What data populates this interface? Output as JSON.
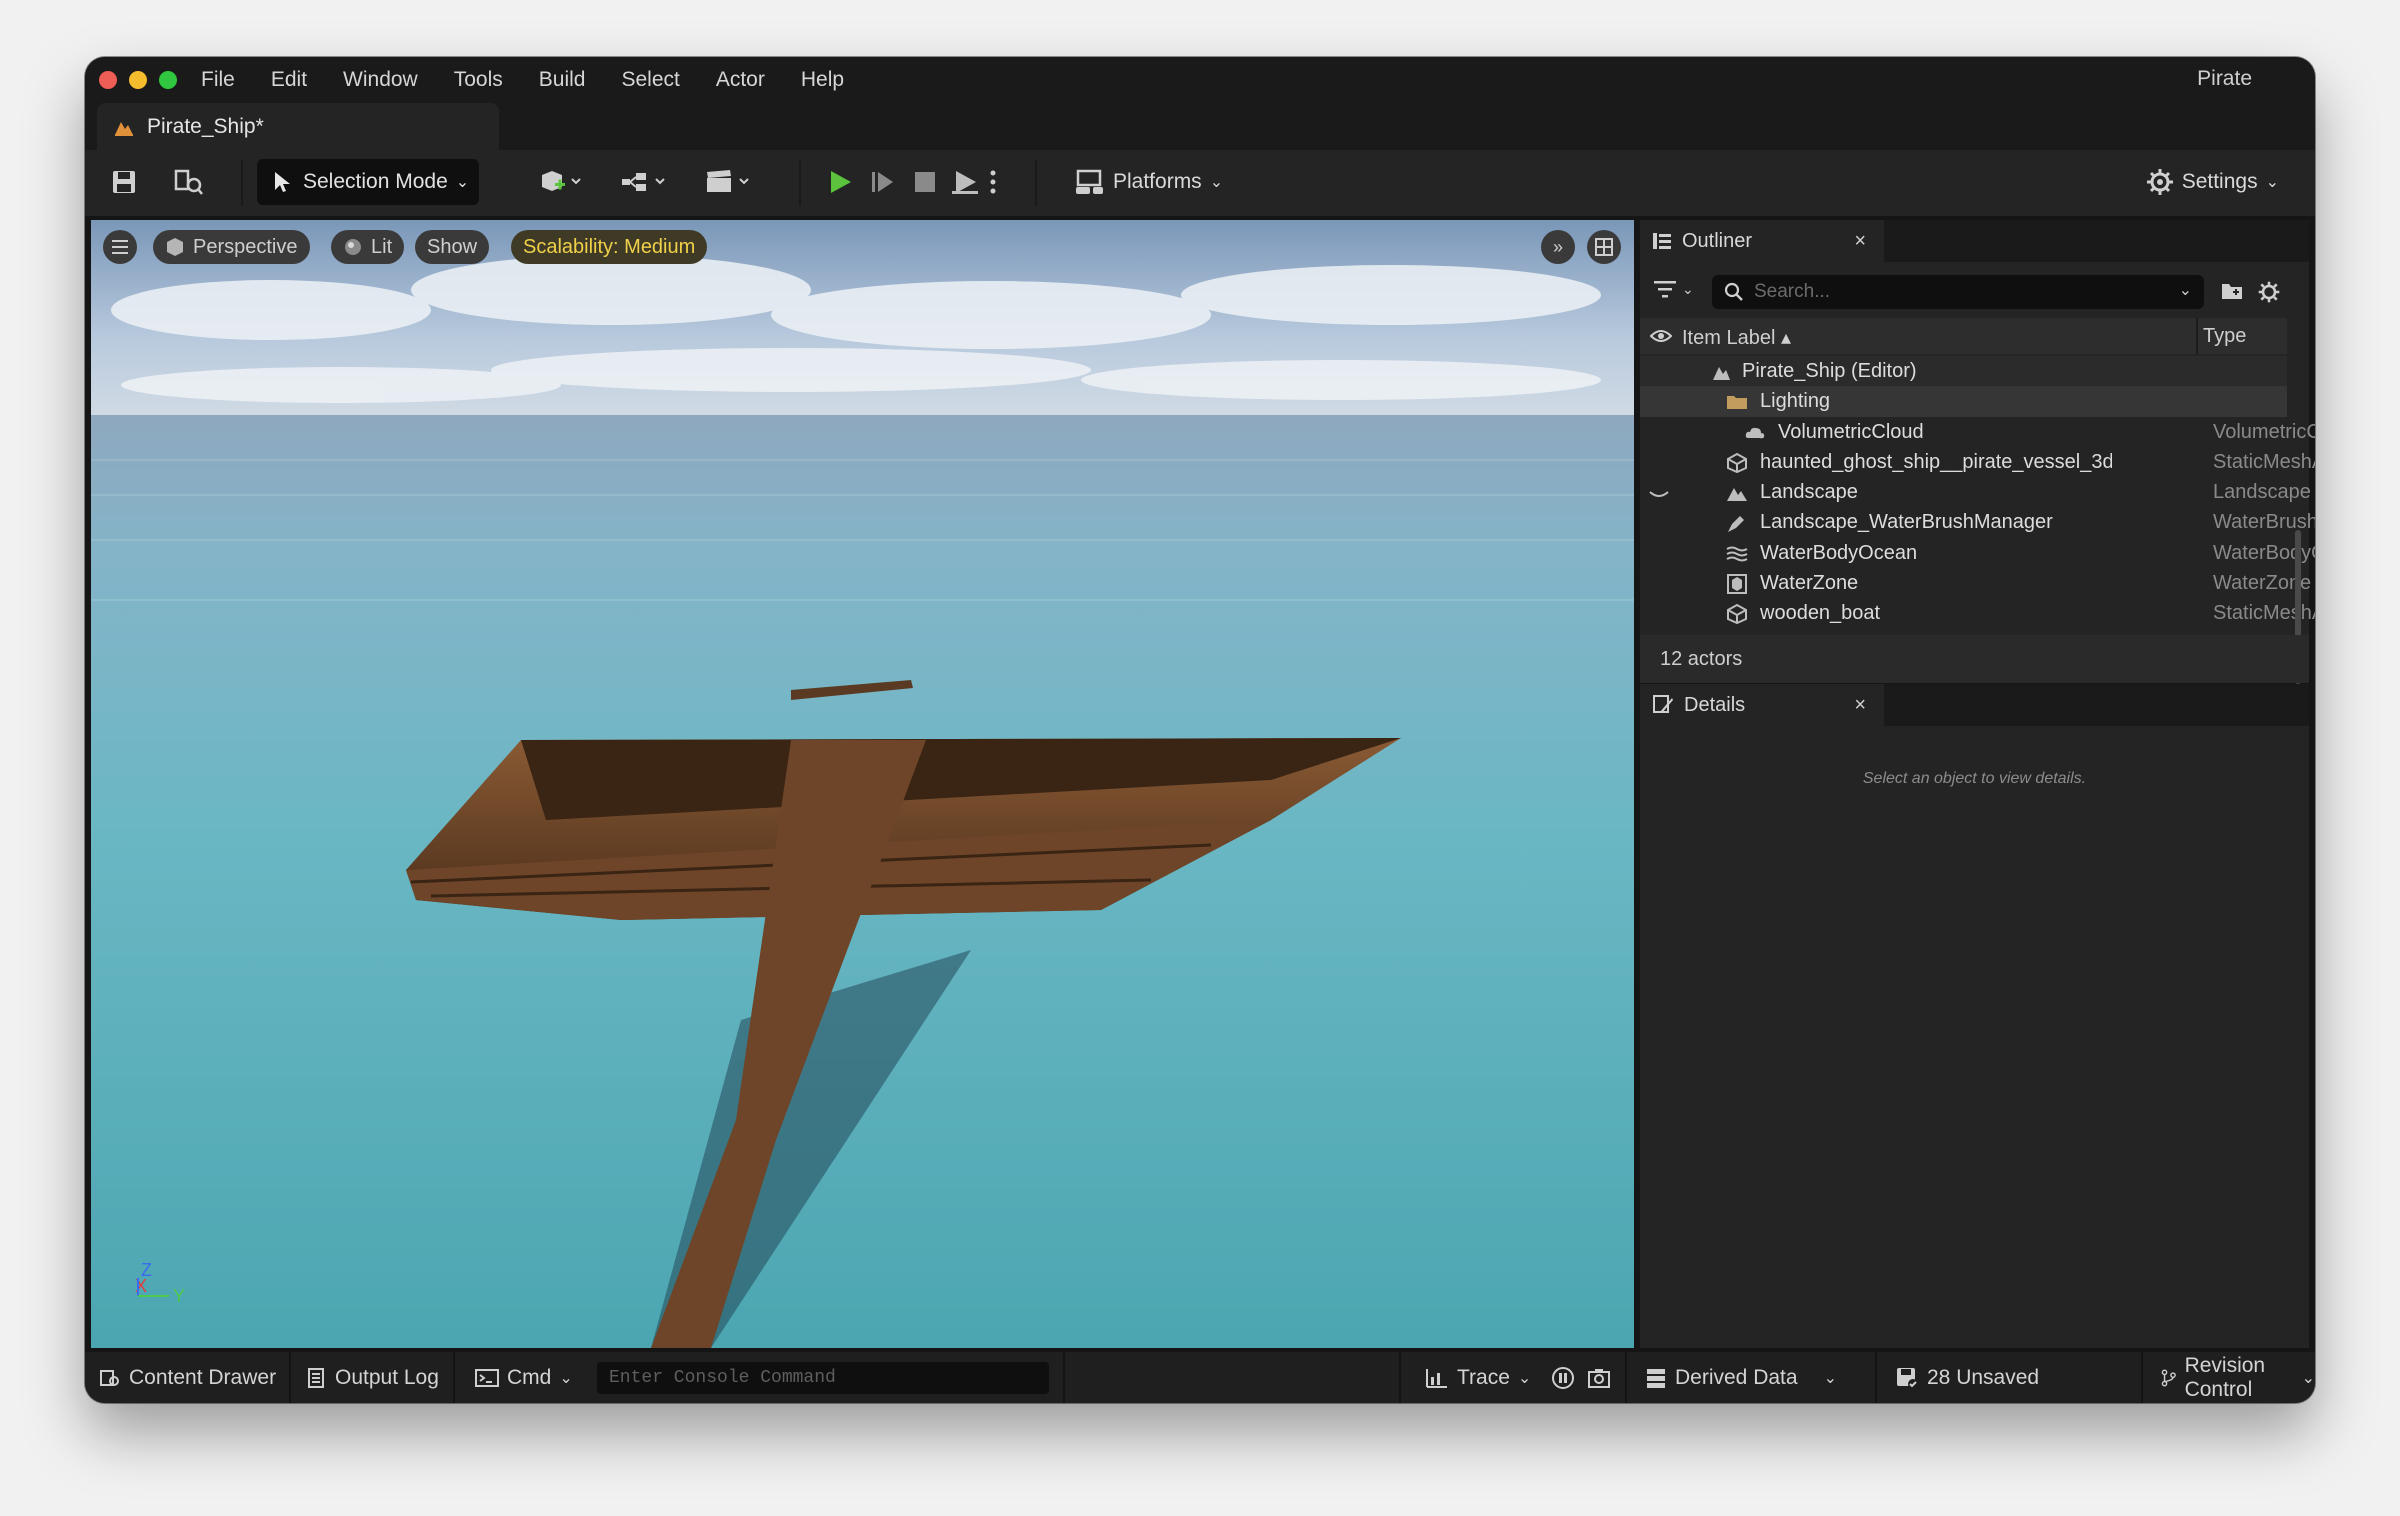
{
  "menu": {
    "items": [
      "File",
      "Edit",
      "Window",
      "Tools",
      "Build",
      "Select",
      "Actor",
      "Help"
    ],
    "project_name": "Pirate"
  },
  "tab": {
    "title": "Pirate_Ship*"
  },
  "toolbar": {
    "selection_mode": "Selection Mode",
    "platforms": "Platforms",
    "settings": "Settings"
  },
  "viewport": {
    "perspective": "Perspective",
    "lit": "Lit",
    "show": "Show",
    "scalability": "Scalability: Medium",
    "axis_z": "Z",
    "axis_x": "X",
    "axis_y": "Y"
  },
  "outliner": {
    "tab_label": "Outliner",
    "close": "×",
    "search_placeholder": "Search...",
    "col_label": "Item Label ▴",
    "col_type": "Type",
    "rows": [
      {
        "label": "Pirate_Ship (Editor)",
        "type": "",
        "icon": "level-icon"
      },
      {
        "label": "Lighting",
        "type": "",
        "icon": "folder-icon"
      },
      {
        "label": "VolumetricCloud",
        "type": "VolumetricCloud",
        "icon": "cloud-icon"
      },
      {
        "label": "haunted_ghost_ship__pirate_vessel_3d",
        "type": "StaticMeshActor",
        "icon": "mesh-icon"
      },
      {
        "label": "Landscape",
        "type": "Landscape",
        "icon": "landscape-icon"
      },
      {
        "label": "Landscape_WaterBrushManager",
        "type": "WaterBrushManager",
        "icon": "brush-icon"
      },
      {
        "label": "WaterBodyOcean",
        "type": "WaterBodyOcean",
        "icon": "water-icon"
      },
      {
        "label": "WaterZone",
        "type": "WaterZone",
        "icon": "zone-icon"
      },
      {
        "label": "wooden_boat",
        "type": "StaticMeshActor",
        "icon": "mesh-icon"
      }
    ],
    "actor_count": "12 actors"
  },
  "details": {
    "tab_label": "Details",
    "close": "×",
    "hint": "Select an object to view details."
  },
  "statusbar": {
    "content_drawer": "Content Drawer",
    "output_log": "Output Log",
    "cmd": "Cmd",
    "console_placeholder": "Enter Console Command",
    "trace": "Trace",
    "derived_data": "Derived Data",
    "unsaved": "28 Unsaved",
    "revision_control": "Revision Control"
  },
  "colors": {
    "window_bg": "#151515",
    "panel_bg": "#242424",
    "play_green": "#5cc43c",
    "scalability_yellow": "#f0d04a",
    "folder_tan": "#c29b5e"
  }
}
